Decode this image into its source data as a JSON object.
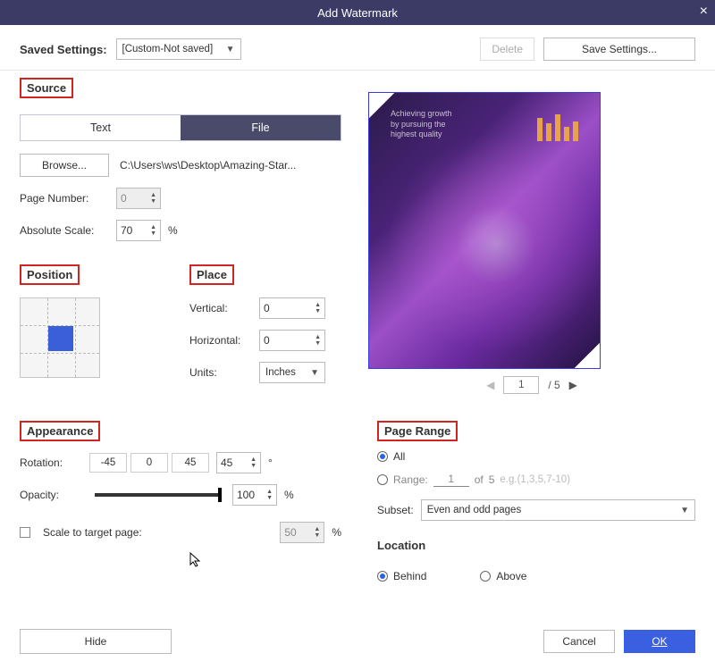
{
  "title": "Add Watermark",
  "savedSettings": {
    "label": "Saved Settings:",
    "value": "[Custom-Not saved]",
    "deleteLabel": "Delete",
    "saveLabel": "Save Settings..."
  },
  "source": {
    "title": "Source",
    "tabs": {
      "text": "Text",
      "file": "File"
    },
    "browseLabel": "Browse...",
    "filePath": "C:\\Users\\ws\\Desktop\\Amazing-Star...",
    "pageNumberLabel": "Page Number:",
    "pageNumberValue": "0",
    "absScaleLabel": "Absolute Scale:",
    "absScaleValue": "70",
    "percent": "%"
  },
  "position": {
    "title": "Position"
  },
  "place": {
    "title": "Place",
    "verticalLabel": "Vertical:",
    "verticalValue": "0",
    "horizontalLabel": "Horizontal:",
    "horizontalValue": "0",
    "unitsLabel": "Units:",
    "unitsValue": "Inches"
  },
  "appearance": {
    "title": "Appearance",
    "rotationLabel": "Rotation:",
    "rotBtns": {
      "neg45": "-45",
      "zero": "0",
      "pos45": "45"
    },
    "rotationValue": "45",
    "degree": "°",
    "opacityLabel": "Opacity:",
    "opacityValue": "100",
    "percent": "%",
    "scaleToTarget": "Scale to target page:",
    "scaleValue": "50"
  },
  "pageRange": {
    "title": "Page Range",
    "all": "All",
    "range": "Range:",
    "rangeFrom": "1",
    "of": "of",
    "total": "5",
    "hint": "e.g.(1,3,5,7-10)",
    "subsetLabel": "Subset:",
    "subsetValue": "Even and odd pages"
  },
  "location": {
    "title": "Location",
    "behind": "Behind",
    "above": "Above"
  },
  "preview": {
    "page": "1",
    "sep": "/ 5",
    "hdr1": "Achieving growth",
    "hdr2": "by pursuing the",
    "hdr3": "highest quality"
  },
  "footer": {
    "hide": "Hide",
    "cancel": "Cancel",
    "ok": "OK"
  }
}
